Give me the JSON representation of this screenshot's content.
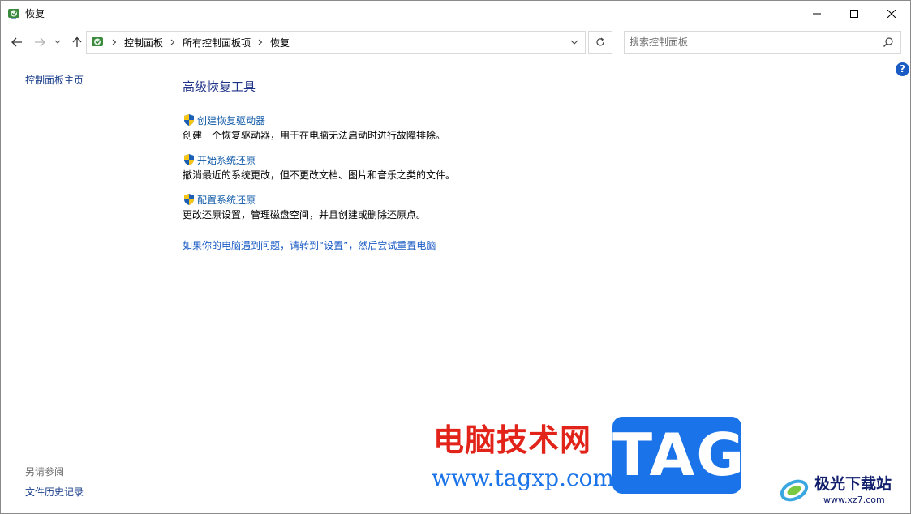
{
  "window": {
    "title": "恢复",
    "title_icon": "recovery-icon"
  },
  "nav": {
    "back_icon": "arrow-left-icon",
    "forward_icon": "arrow-right-icon",
    "recent_icon": "chevron-down-icon",
    "up_icon": "arrow-up-icon"
  },
  "address": {
    "crumbs": [
      "控制面板",
      "所有控制面板项",
      "恢复"
    ]
  },
  "search": {
    "placeholder": "搜索控制面板"
  },
  "left_pane": {
    "home_link": "控制面板主页",
    "see_also_heading": "另请参阅",
    "file_history_link": "文件历史记录"
  },
  "main": {
    "title": "高级恢复工具",
    "tasks": [
      {
        "label": "创建恢复驱动器",
        "desc": "创建一个恢复驱动器，用于在电脑无法启动时进行故障排除。"
      },
      {
        "label": "开始系统还原",
        "desc": "撤消最近的系统更改，但不更改文档、图片和音乐之类的文件。"
      },
      {
        "label": "配置系统还原",
        "desc": "更改还原设置，管理磁盘空间，并且创建或删除还原点。"
      }
    ],
    "reset_link": "如果你的电脑遇到问题，请转到“设置”，然后尝试重置电脑"
  },
  "help": {
    "label": "?"
  },
  "watermark": {
    "site_name_cn": "电脑技术网",
    "site_url": "www.tagxp.com",
    "tag": "TAG",
    "xz_name": "极光下载站",
    "xz_url": "www.xz7.com"
  },
  "colors": {
    "link": "#0b57a6",
    "title": "#1e3287",
    "watermark_red": "#e2231a",
    "watermark_blue": "#1a73e8"
  }
}
